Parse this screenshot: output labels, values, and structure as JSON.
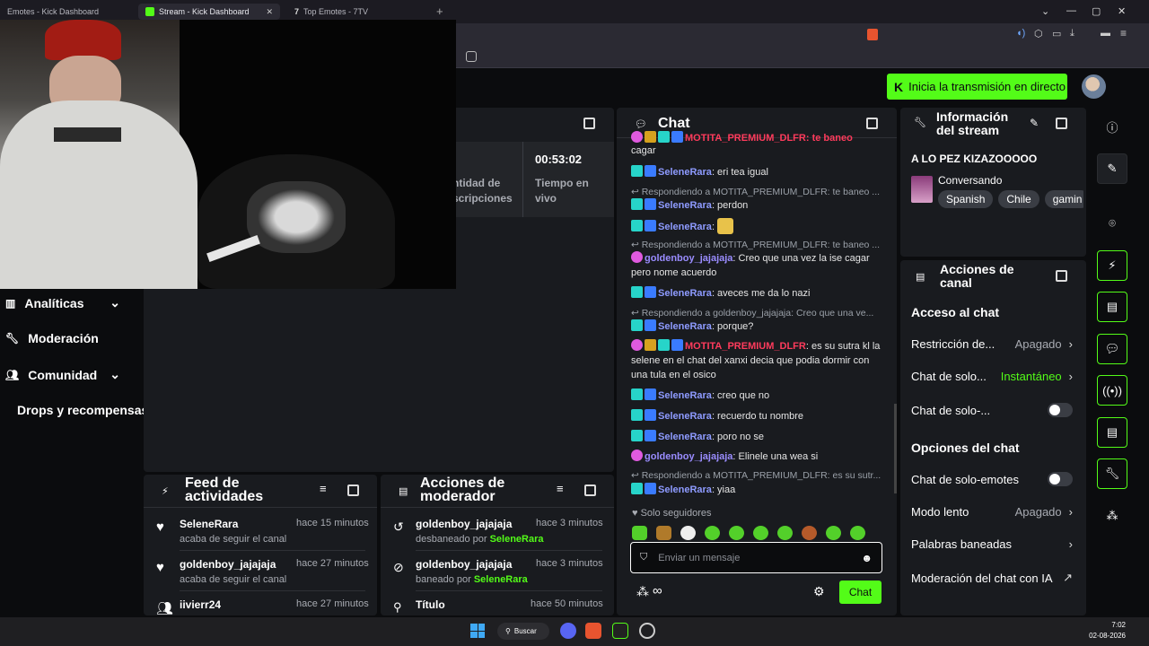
{
  "browser": {
    "tabs": [
      {
        "label": "Emotes - Kick Dashboard",
        "active": false
      },
      {
        "label": "Stream - Kick Dashboard",
        "active": true
      },
      {
        "label": "Top Emotes - 7TV",
        "active": false
      }
    ],
    "new_tab": "+"
  },
  "header": {
    "go_live_label": "Inicia la transmisión en directo"
  },
  "sidebar": {
    "items": [
      {
        "label": "Analíticas"
      },
      {
        "label": "Moderación"
      },
      {
        "label": "Comunidad"
      },
      {
        "label": "Drops y recompensas"
      }
    ]
  },
  "stats": {
    "subs_label": "ntidad de\nscripciones",
    "time_value": "00:53:02",
    "time_label": "Tiempo en\nvivo"
  },
  "chat": {
    "title": "Chat",
    "lines": [
      {
        "type": "msg",
        "user": "",
        "text": "cagar"
      },
      {
        "type": "msg",
        "user": "SeleneRara",
        "text": ": eri tea igual"
      },
      {
        "type": "reply",
        "text": "Respondiendo a MOTITA_PREMIUM_DLFR: te baneo ..."
      },
      {
        "type": "msg",
        "user": "SeleneRara",
        "text": ": perdon"
      },
      {
        "type": "msg",
        "user": "SeleneRara",
        "text": ":"
      },
      {
        "type": "reply",
        "text": "Respondiendo a MOTITA_PREMIUM_DLFR: te baneo ..."
      },
      {
        "type": "msg",
        "user": "goldenboy_jajajaja",
        "text": ": Creo que una vez la ise cagar pero nome acuerdo"
      },
      {
        "type": "msg",
        "user": "SeleneRara",
        "text": ": aveces me da lo nazi"
      },
      {
        "type": "reply",
        "text": "Respondiendo a goldenboy_jajajaja: Creo que una ve..."
      },
      {
        "type": "msg",
        "user": "SeleneRara",
        "text": ": porque?"
      },
      {
        "type": "msg",
        "user": "MOTITA_PREMIUM_DLFR",
        "text": ": es su sutra kl la selene en el chat del xanxi decia que podia dormir con una tula en el osico"
      },
      {
        "type": "msg",
        "user": "SeleneRara",
        "text": ": creo que no"
      },
      {
        "type": "msg",
        "user": "SeleneRara",
        "text": ": recuerdo tu nombre"
      },
      {
        "type": "msg",
        "user": "SeleneRara",
        "text": ": poro no se"
      },
      {
        "type": "msg",
        "user": "goldenboy_jajajaja",
        "text": ": Elinele una wea si"
      },
      {
        "type": "reply",
        "text": "Respondiendo a MOTITA_PREMIUM_DLFR: es su sutr..."
      },
      {
        "type": "msg",
        "user": "SeleneRara",
        "text": ": yiaa"
      }
    ],
    "top_cut": "MOTITA_PREMIUM_DLFR: te baneo hacela",
    "followers_only": "Solo seguidores",
    "input_placeholder": "Enviar un mensaje",
    "send_label": "Chat"
  },
  "stream_info": {
    "title": "Información\ndel stream",
    "stream_title": "A LO PEZ KIZAZOOOOO",
    "category": "Conversando",
    "tags": [
      "Spanish",
      "Chile",
      "gamin"
    ]
  },
  "channel_actions": {
    "title": "Acciones de\ncanal",
    "section1": "Acceso al chat",
    "rows1": [
      {
        "label": "Restricción de...",
        "value": "Apagado"
      },
      {
        "label": "Chat de solo...",
        "value": "Instantáneo"
      },
      {
        "label": "Chat de solo-...",
        "value": ""
      }
    ],
    "section2": "Opciones del chat",
    "rows2": [
      {
        "label": "Chat de solo-emotes",
        "value": ""
      },
      {
        "label": "Modo lento",
        "value": "Apagado"
      },
      {
        "label": "Palabras baneadas",
        "value": ""
      },
      {
        "label": "Moderación del chat con IA",
        "value": ""
      }
    ]
  },
  "activity": {
    "title": "Feed de\nactividades",
    "items": [
      {
        "user": "SeleneRara",
        "time": "hace 15 minutos",
        "desc": "acaba de seguir el canal"
      },
      {
        "user": "goldenboy_jajajaja",
        "time": "hace 27 minutos",
        "desc": "acaba de seguir el canal"
      },
      {
        "user": "iivierr24",
        "time": "hace 27 minutos",
        "desc": ""
      }
    ]
  },
  "mod_actions": {
    "title": "Acciones de\nmoderador",
    "items": [
      {
        "user": "goldenboy_jajajaja",
        "time": "hace 3 minutos",
        "desc": "desbaneado por ",
        "by": "SeleneRara"
      },
      {
        "user": "goldenboy_jajajaja",
        "time": "hace 3 minutos",
        "desc": "baneado por ",
        "by": "SeleneRara"
      },
      {
        "user": "Título",
        "time": "hace 50 minutos",
        "desc": "",
        "by": ""
      }
    ]
  },
  "taskbar": {
    "search": "Buscar",
    "time": "7:02",
    "date": "02-08-2026"
  },
  "colors": {
    "accent": "#53fc18",
    "panel": "#191b1f",
    "bg": "#0b0c0e"
  }
}
